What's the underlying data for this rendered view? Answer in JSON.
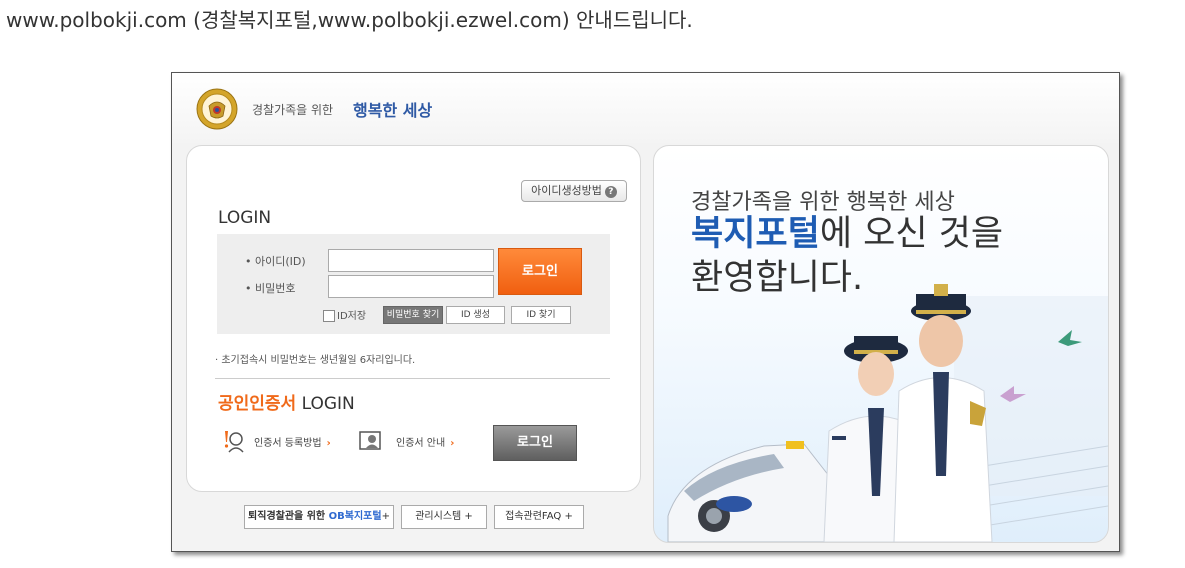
{
  "intro_text": "www.polbokji.com (경찰복지포털,www.polbokji.ezwel.com) 안내드립니다.",
  "header": {
    "brand_small": "경찰가족을 위한",
    "brand_big": "행복한 세상"
  },
  "login": {
    "id_help_label": "아이디생성방법",
    "title": "LOGIN",
    "id_label": "아이디(ID)",
    "pw_label": "비밀번호",
    "id_value": "",
    "pw_value": "",
    "login_button": "로그인",
    "save_id_label": "ID저장",
    "find_pw_button": "비밀번호 찾기",
    "create_id_button": "ID 생성",
    "find_id_button": "ID 찾기",
    "notice": "· 초기접속시 비밀번호는 생년월일 6자리입니다."
  },
  "cert": {
    "title_highlight": "공인인증서",
    "title_rest": " LOGIN",
    "register_link": "인증서 등록방법",
    "guide_link": "인증서 안내",
    "arrow": "›",
    "login_button": "로그인"
  },
  "bottom_links": {
    "ob_prefix": "퇴직경찰관을 위한 ",
    "ob_highlight": "OB복지포털",
    "ob_suffix": "+",
    "admin": "관리시스템 +",
    "faq": "접속관련FAQ +"
  },
  "hero": {
    "subtitle": "경찰가족을 위한 행복한 세상",
    "headline_highlight": "복지포털",
    "headline_rest": "에 오신 것을",
    "headline_line2": "환영합니다."
  },
  "colors": {
    "accent_orange": "#f06a1a",
    "brand_blue": "#2f5aa5",
    "headline_blue": "#1e5cb3"
  }
}
